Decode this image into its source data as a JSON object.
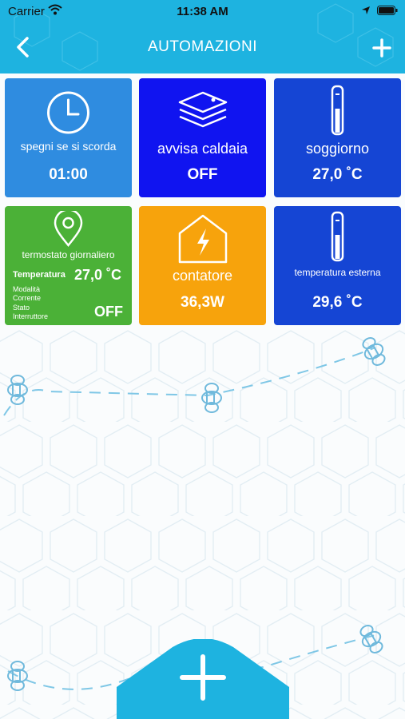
{
  "status_bar": {
    "carrier": "Carrier",
    "time": "11:38 AM"
  },
  "nav": {
    "title": "AUTOMAZIONI",
    "back_icon": "chevron-left-icon",
    "add_icon": "plus-icon"
  },
  "tiles": [
    {
      "icon": "clock-icon",
      "label": "spegni se si scorda",
      "value": "01:00",
      "color": "#2f8ce0"
    },
    {
      "icon": "layers-icon",
      "label": "avvisa caldaia",
      "value": "OFF",
      "color": "#1014f0"
    },
    {
      "icon": "thermometer-icon",
      "label": "soggiorno",
      "value": "27,0 ˚C",
      "color": "#1545d4"
    },
    {
      "icon": "location-pin-icon",
      "label": "termostato giornaliero",
      "temperature_label": "Temperatura",
      "temperature_value": "27,0 ˚C",
      "mode_label": "Modalità Corrente",
      "switch_label": "Stato Interruttore",
      "value": "OFF",
      "color": "#4bb137"
    },
    {
      "icon": "house-lightning-icon",
      "label": "contatore",
      "value": "36,3W",
      "color": "#f7a30c"
    },
    {
      "icon": "thermometer-icon",
      "label": "temperatura esterna",
      "value": "29,6 ˚C",
      "color": "#1545d4"
    }
  ],
  "fab": {
    "icon": "plus-icon",
    "color": "#1eb3e0"
  },
  "colors": {
    "header": "#1eb3e0",
    "background": "#fafcfd"
  }
}
